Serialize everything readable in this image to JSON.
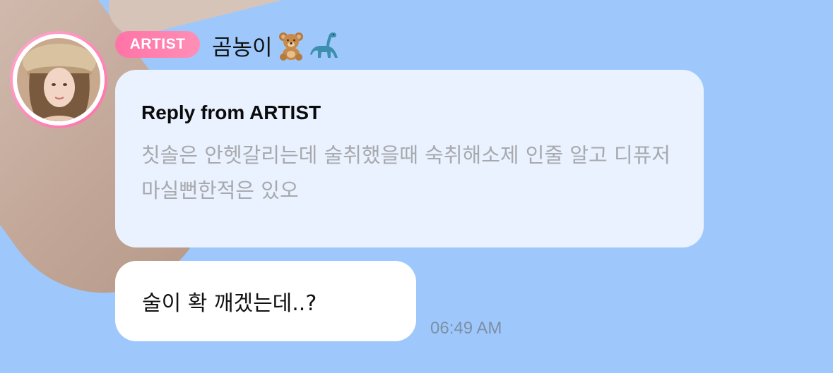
{
  "chat": {
    "badge": "ARTIST",
    "artist_name": "곰농이",
    "name_emojis": [
      "teddy-bear-icon",
      "dinosaur-icon"
    ],
    "reply": {
      "title": "Reply from ARTIST",
      "text": "칫솔은 안헷갈리는데 술취했을때 숙취해소제 인줄 알고 디퓨저 마실뻔한적은 있오"
    },
    "message": {
      "text": "술이 확 깨겠는데..?",
      "time": "06:49 AM"
    }
  },
  "colors": {
    "background": "#9ec8fb",
    "badge_pink": "#ff7aa9",
    "reply_bubble": "#eaf2ff",
    "reply_text": "#a7a9ad",
    "message_bubble": "#ffffff",
    "timestamp": "#7d8fa6"
  }
}
